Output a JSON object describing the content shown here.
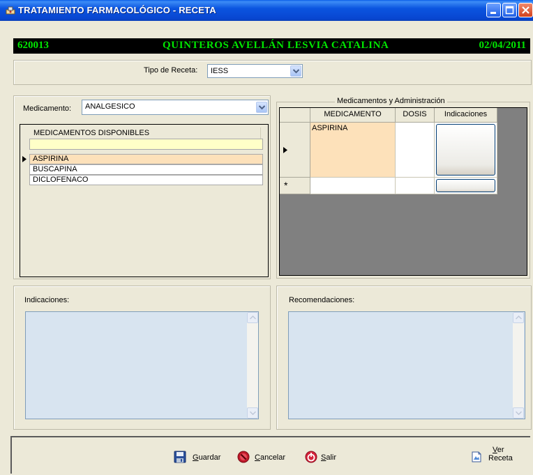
{
  "window": {
    "title": "TRATAMIENTO FARMACOLÓGICO -  RECETA",
    "icon": "app-icon"
  },
  "patient": {
    "id": "620013",
    "name": "QUINTEROS AVELLÁN LESVIA CATALINA",
    "date": "02/04/2011",
    "text_color": "#00e600",
    "background": "#000000"
  },
  "tipo_receta": {
    "label": "Tipo de Receta:",
    "value": "IESS"
  },
  "medicamento": {
    "label": "Medicamento:",
    "value": "ANALGESICO"
  },
  "disponibles": {
    "header": "MEDICAMENTOS DISPONIBLES",
    "filter_value": "",
    "rows": [
      "ASPIRINA",
      "BUSCAPINA",
      "DICLOFENACO"
    ],
    "selected_index": 0
  },
  "administracion": {
    "legend": "Medicamentos y Administración",
    "columns": [
      "MEDICAMENTO",
      "DOSIS",
      "Indicaciones"
    ],
    "rows": [
      {
        "medicamento": "ASPIRINA",
        "dosis": "",
        "indicaciones": ""
      }
    ],
    "new_row_marker": "*"
  },
  "indicaciones": {
    "label": "Indicaciones:",
    "value": ""
  },
  "recomendaciones": {
    "label": "Recomendaciones:",
    "value": ""
  },
  "toolbar": {
    "guardar": {
      "label": "Guardar",
      "mnemonic": "G",
      "rest": "uardar",
      "icon": "save-icon"
    },
    "cancelar": {
      "label": "Cancelar",
      "mnemonic": "C",
      "rest": "ancelar",
      "icon": "cancel-icon"
    },
    "salir": {
      "label": "Salir",
      "mnemonic": "S",
      "rest": "alir",
      "icon": "exit-icon"
    },
    "ver_receta": {
      "line1_mnemonic": "V",
      "line1_rest": "er",
      "line2": "Receta",
      "icon": "document-icon"
    }
  },
  "colors": {
    "titlebar": "#0b55e0",
    "window_bg": "#ece9d8",
    "selected_row": "#fde1ba",
    "filter_row": "#ffffc8",
    "memo_bg": "#d8e4f0"
  }
}
